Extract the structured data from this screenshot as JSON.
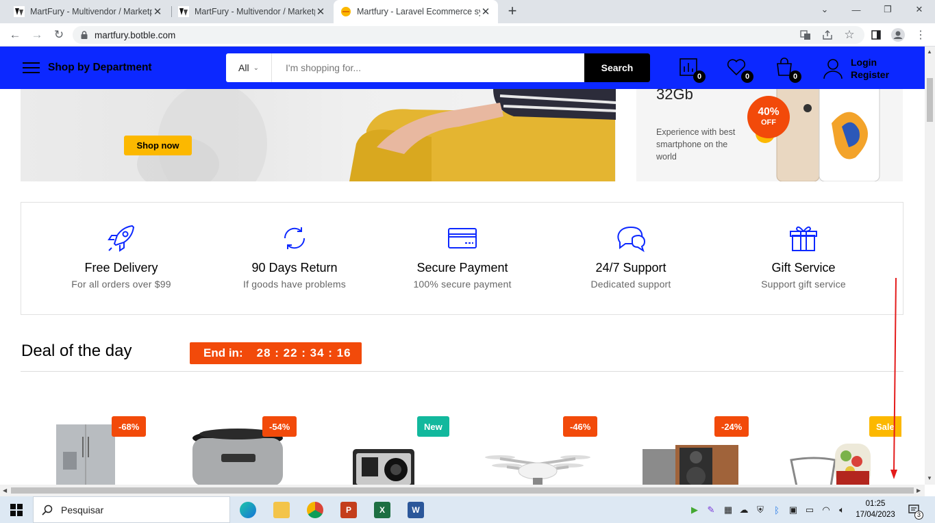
{
  "browser": {
    "tabs": [
      {
        "title": "MartFury - Multivendor / Marketp",
        "active": false
      },
      {
        "title": "MartFury - Multivendor / Marketp",
        "active": false
      },
      {
        "title": "Martfury - Laravel Ecommerce sy",
        "active": true
      }
    ],
    "url": "martfury.botble.com"
  },
  "header": {
    "department_label": "Shop by Department",
    "search_category": "All",
    "search_placeholder": "I'm shopping for...",
    "search_button": "Search",
    "compare_count": "0",
    "wishlist_count": "0",
    "cart_count": "0",
    "login_label": "Login",
    "register_label": "Register",
    "accent_color": "#0c28ff"
  },
  "banners": {
    "left": {
      "button": "Shop now"
    },
    "right": {
      "title": "32Gb",
      "text": "Experience with best smartphone on the world",
      "badge_percent": "40%",
      "badge_off": "OFF"
    }
  },
  "features": [
    {
      "icon": "rocket-icon",
      "title": "Free Delivery",
      "subtitle": "For all orders over $99"
    },
    {
      "icon": "refresh-icon",
      "title": "90 Days Return",
      "subtitle": "If goods have problems"
    },
    {
      "icon": "credit-card-icon",
      "title": "Secure Payment",
      "subtitle": "100% secure payment"
    },
    {
      "icon": "chat-icon",
      "title": "24/7 Support",
      "subtitle": "Dedicated support"
    },
    {
      "icon": "gift-icon",
      "title": "Gift Service",
      "subtitle": "Support gift service"
    }
  ],
  "deal": {
    "title": "Deal of the day",
    "end_label": "End in:",
    "countdown": "28 : 22 : 34 : 16",
    "products": [
      {
        "tag": "-68%",
        "tag_color": "#f24a0a",
        "icon": "refrigerator-icon"
      },
      {
        "tag": "-54%",
        "tag_color": "#f24a0a",
        "icon": "rice-cooker-icon"
      },
      {
        "tag": "New",
        "tag_color": "#12b89d",
        "icon": "action-camera-icon"
      },
      {
        "tag": "-46%",
        "tag_color": "#f24a0a",
        "icon": "drone-icon"
      },
      {
        "tag": "-24%",
        "tag_color": "#f24a0a",
        "icon": "speakers-icon"
      },
      {
        "tag": "Sale",
        "tag_color": "#fcb800",
        "icon": "blender-icon"
      }
    ]
  },
  "taskbar": {
    "search_placeholder": "Pesquisar",
    "time": "01:25",
    "date": "17/04/2023",
    "notification_count": "3"
  }
}
